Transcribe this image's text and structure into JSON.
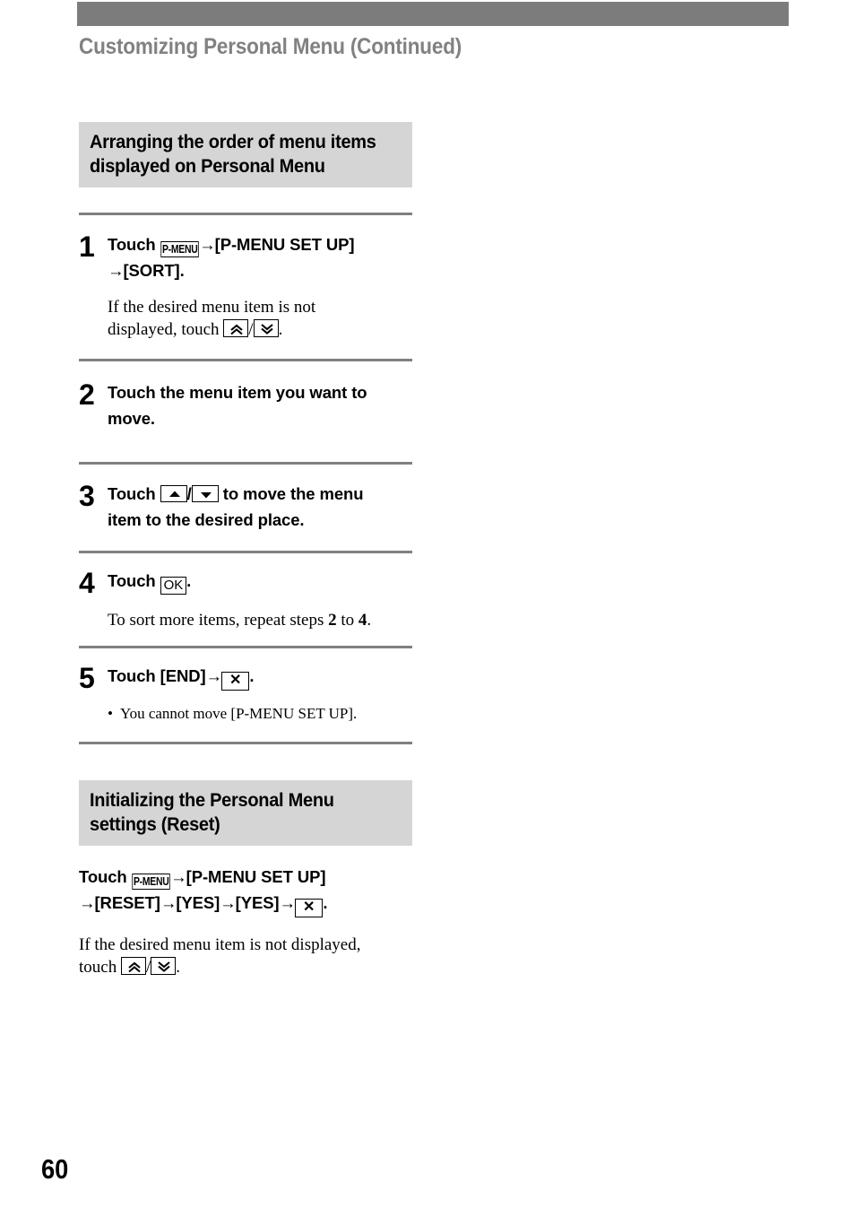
{
  "page": {
    "running_head": "Customizing Personal Menu (Continued)",
    "page_number": "60",
    "header_bar_color": "#7c7c7c",
    "heading_band_color": "#d5d5d5",
    "running_head_color": "#818181",
    "rule_color": "#808080"
  },
  "icons": {
    "p_menu_label": "P-MENU",
    "ok_label": "OK",
    "x_label": "✕",
    "chevron_up_name": "chevron-up-double-icon",
    "chevron_down_name": "chevron-down-double-icon",
    "triangle_up_name": "triangle-up-icon",
    "triangle_down_name": "triangle-down-icon",
    "arrow": "→",
    "slash": "/",
    "bullet": "•"
  },
  "sections": [
    {
      "heading_line1": "Arranging the order of menu items",
      "heading_line2": "displayed on Personal Menu",
      "steps": [
        {
          "number": "1",
          "bold_pre": "Touch ",
          "bold_mid": "[P-MENU SET UP]",
          "bold_line2_pre": "",
          "bold_line2_post": "[SORT].",
          "note_pre": "If the desired menu item is not",
          "note_line2_pre": "displayed, touch ",
          "note_line2_post": "."
        },
        {
          "number": "2",
          "bold_line1": "Touch the menu item you want to",
          "bold_line2": "move."
        },
        {
          "number": "3",
          "bold_pre": "Touch ",
          "bold_post": " to move the menu",
          "bold_line2": "item to the desired place."
        },
        {
          "number": "4",
          "bold_pre": "Touch ",
          "bold_post": ".",
          "note_a": "To sort more items, repeat steps ",
          "note_b": "2",
          "note_c": " to ",
          "note_d": "4",
          "note_e": "."
        },
        {
          "number": "5",
          "bold_pre": "Touch [END]",
          "bold_post": ".",
          "bullet_text": "You cannot move [P-MENU SET UP]."
        }
      ]
    },
    {
      "heading_line1": "Initializing the Personal Menu",
      "heading_line2": "settings (Reset)",
      "instruction": {
        "bold_pre": "Touch ",
        "bold_mid": "[P-MENU SET UP]",
        "bold_line2_a": "[RESET]",
        "bold_line2_b": "[YES]",
        "bold_line2_c": "[YES]",
        "bold_line2_end": "."
      },
      "note": {
        "line1": "If the desired menu item is not displayed,",
        "line2_pre": "touch ",
        "line2_post": "."
      }
    }
  ]
}
